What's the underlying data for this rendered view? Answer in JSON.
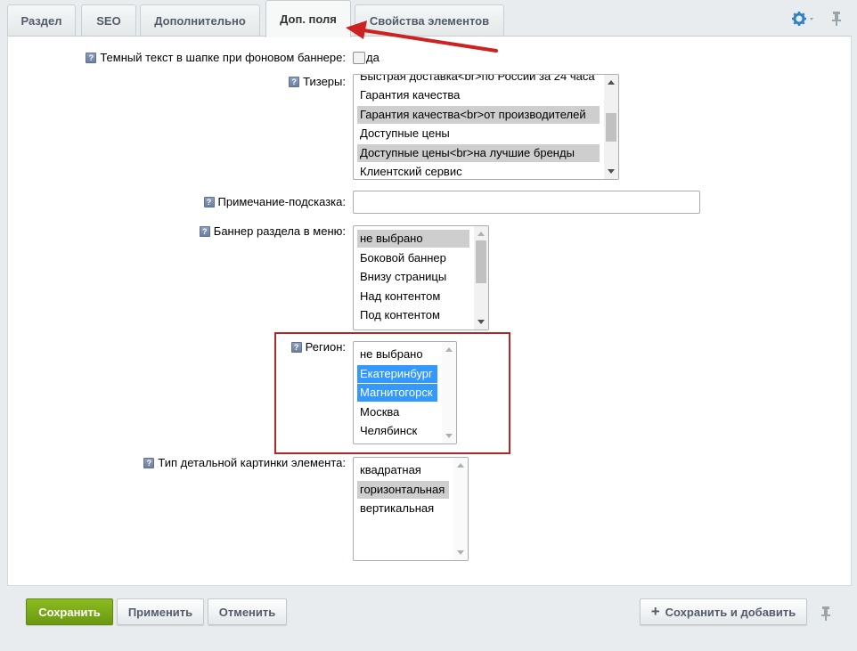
{
  "tabs": [
    {
      "label": "Раздел"
    },
    {
      "label": "SEO"
    },
    {
      "label": "Дополнительно"
    },
    {
      "label": "Доп. поля"
    },
    {
      "label": "Свойства элементов"
    }
  ],
  "active_tab": "Доп. поля",
  "header_icons": {
    "settings": "gear-icon",
    "pin": "pin-icon"
  },
  "colors": {
    "accent_blue": "#3399ff",
    "save_green": "#76a81a",
    "highlight_red": "#b22727",
    "annotation_arrow": "#cc2222"
  },
  "hint_glyph": "?",
  "fields": {
    "dark_text": {
      "label": "Темный текст в шапке при фоновом баннере:",
      "checkbox_label": "да",
      "checked": false
    },
    "teasers": {
      "label": "Тизеры:",
      "options": [
        {
          "text": "Быстрая доставка<br>по России за 24 часа",
          "selected": false
        },
        {
          "text": "Гарантия качества",
          "selected": false
        },
        {
          "text": "Гарантия качества<br>от производителей",
          "selected": true
        },
        {
          "text": "Доступные цены",
          "selected": false
        },
        {
          "text": "Доступные цены<br>на лучшие бренды",
          "selected": true
        },
        {
          "text": "Клиентский сервис",
          "selected": false
        }
      ]
    },
    "note_hint": {
      "label": "Примечание-подсказка:",
      "value": ""
    },
    "menu_banner": {
      "label": "Баннер раздела в меню:",
      "options": [
        {
          "text": "не выбрано",
          "selected": true
        },
        {
          "text": "Боковой баннер",
          "selected": false
        },
        {
          "text": "Внизу страницы",
          "selected": false
        },
        {
          "text": "Над контентом",
          "selected": false
        },
        {
          "text": "Под контентом",
          "selected": false
        }
      ]
    },
    "region": {
      "label": "Регион:",
      "options": [
        {
          "text": "не выбрано",
          "selected": false
        },
        {
          "text": "Екатеринбург",
          "selected": true
        },
        {
          "text": "Магнитогорск",
          "selected": true
        },
        {
          "text": "Москва",
          "selected": false
        },
        {
          "text": "Челябинск",
          "selected": false
        }
      ]
    },
    "detail_picture_type": {
      "label": "Тип детальной картинки элемента:",
      "options": [
        {
          "text": "квадратная",
          "selected": false
        },
        {
          "text": "горизонтальная",
          "selected": true
        },
        {
          "text": "вертикальная",
          "selected": false
        }
      ]
    }
  },
  "buttons": {
    "save": "Сохранить",
    "apply": "Применить",
    "cancel": "Отменить",
    "save_and_add": "Сохранить и добавить"
  }
}
